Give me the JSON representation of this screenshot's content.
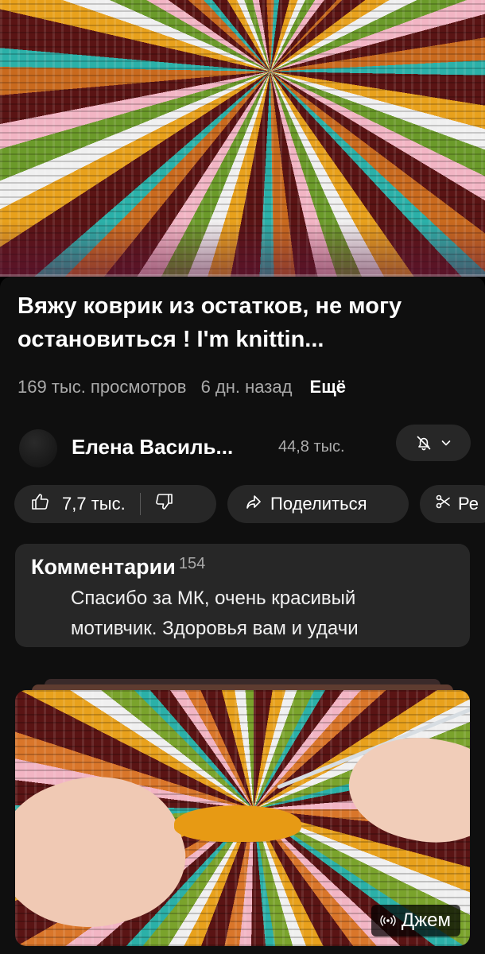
{
  "player": {
    "progress_fraction": 0.0
  },
  "video": {
    "title": "Вяжу коврик из остатков, не могу остановиться ! I'm knittin...",
    "views": "169 тыс. просмотров",
    "age": "6 дн. назад",
    "more_label": "Ещё"
  },
  "channel": {
    "name": "Елена Василь...",
    "subscribers": "44,8 тыс.",
    "bell_icon": "bell-off-icon",
    "chevron_icon": "chevron-down-icon"
  },
  "actions": {
    "likes": "7,7 тыс.",
    "like_icon": "thumbs-up-icon",
    "dislike_icon": "thumbs-down-icon",
    "share_label": "Поделиться",
    "share_icon": "share-icon",
    "remix_label": "Ре",
    "remix_icon": "remix-icon"
  },
  "comments": {
    "title": "Комментарии",
    "count": "154",
    "top_comment": "Спасибо за МК, очень красивый мотивчик. Здоровья вам и удачи"
  },
  "next_video": {
    "badge_label": "Джем",
    "badge_icon": "live-broadcast-icon"
  },
  "colors": {
    "background": "#0f0f0f",
    "surface": "#272727",
    "secondary_text": "#aaaaaa",
    "accent": "#ff0000"
  }
}
